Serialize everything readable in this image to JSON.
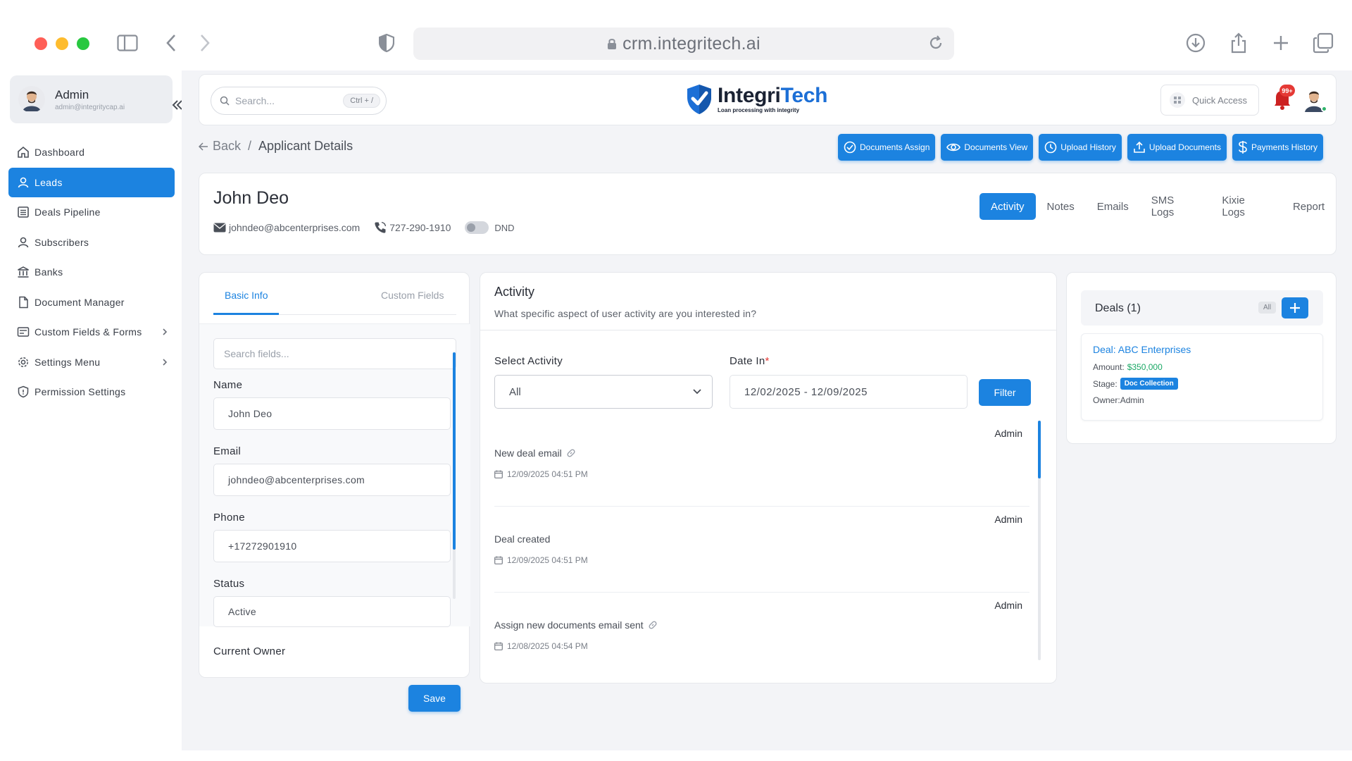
{
  "browser": {
    "url": "crm.integritech.ai",
    "traffic_light_colors": [
      "#ff5f57",
      "#febc2e",
      "#28c840"
    ]
  },
  "sidebar": {
    "user": {
      "name": "Admin",
      "email": "admin@integritycap.ai"
    },
    "items": [
      {
        "label": "Dashboard",
        "icon": "home-icon"
      },
      {
        "label": "Leads",
        "icon": "user-icon",
        "active": true
      },
      {
        "label": "Deals Pipeline",
        "icon": "list-icon"
      },
      {
        "label": "Subscribers",
        "icon": "user-icon"
      },
      {
        "label": "Banks",
        "icon": "bank-icon"
      },
      {
        "label": "Document Manager",
        "icon": "document-icon"
      },
      {
        "label": "Custom Fields & Forms",
        "icon": "form-icon",
        "has_submenu": true
      },
      {
        "label": "Settings Menu",
        "icon": "gear-icon",
        "has_submenu": true
      },
      {
        "label": "Permission Settings",
        "icon": "shield-icon"
      }
    ]
  },
  "topbar": {
    "search_placeholder": "Search...",
    "search_shortcut": "Ctrl + /",
    "logo": {
      "brand_first": "Integri",
      "brand_second": "Tech",
      "tagline": "Loan processing with integrity"
    },
    "quick_access_label": "Quick Access",
    "notification_count": "99+"
  },
  "breadcrumb": {
    "back_label": "Back",
    "separator": "/",
    "current": "Applicant Details"
  },
  "actions": [
    {
      "label": "Documents Assign",
      "icon": "check-circle-icon"
    },
    {
      "label": "Documents View",
      "icon": "eye-icon"
    },
    {
      "label": "Upload History",
      "icon": "clock-icon"
    },
    {
      "label": "Upload Documents",
      "icon": "upload-icon"
    },
    {
      "label": "Payments History",
      "icon": "dollar-icon"
    }
  ],
  "applicant": {
    "name": "John Deo",
    "email": "johndeo@abcenterprises.com",
    "phone": "727-290-1910",
    "dnd_label": "DND",
    "dnd_enabled": false
  },
  "profile_tabs": [
    "Activity",
    "Notes",
    "Emails",
    "SMS Logs",
    "Kixie Logs",
    "Report"
  ],
  "profile_active_tab": "Activity",
  "info_panel": {
    "tabs": [
      "Basic Info",
      "Custom Fields"
    ],
    "search_placeholder": "Search fields...",
    "fields": [
      {
        "label": "Name",
        "value": "John Deo"
      },
      {
        "label": "Email",
        "value": "johndeo@abcenterprises.com"
      },
      {
        "label": "Phone",
        "value": "+17272901910"
      },
      {
        "label": "Status",
        "value": "Active"
      },
      {
        "label": "Current Owner",
        "value": ""
      }
    ],
    "save_label": "Save"
  },
  "activity": {
    "title": "Activity",
    "subtitle": "What specific aspect of user activity are you interested in?",
    "select_label": "Select Activity",
    "select_value": "All",
    "date_label": "Date In",
    "date_required_mark": "*",
    "date_value": "12/02/2025 - 12/09/2025",
    "filter_label": "Filter",
    "items": [
      {
        "user": "Admin",
        "text": "New deal email",
        "has_link": true,
        "date": "12/09/2025 04:51 PM"
      },
      {
        "user": "Admin",
        "text": "Deal created",
        "has_link": false,
        "date": "12/09/2025 04:51 PM"
      },
      {
        "user": "Admin",
        "text": "Assign new documents email sent",
        "has_link": true,
        "date": "12/08/2025 04:54 PM"
      }
    ]
  },
  "deals": {
    "title": "Deals (1)",
    "filter_label": "All",
    "add_label": "+",
    "cards": [
      {
        "name": "Deal: ABC Enterprises",
        "amount_label": "Amount:",
        "amount": "$350,000",
        "stage_label": "Stage:",
        "stage": "Doc Collection",
        "owner_label": "Owner:",
        "owner": "Admin"
      }
    ]
  },
  "colors": {
    "accent": "#1c83e0",
    "amount_green": "#1aa865",
    "badge_red": "#e53935"
  }
}
